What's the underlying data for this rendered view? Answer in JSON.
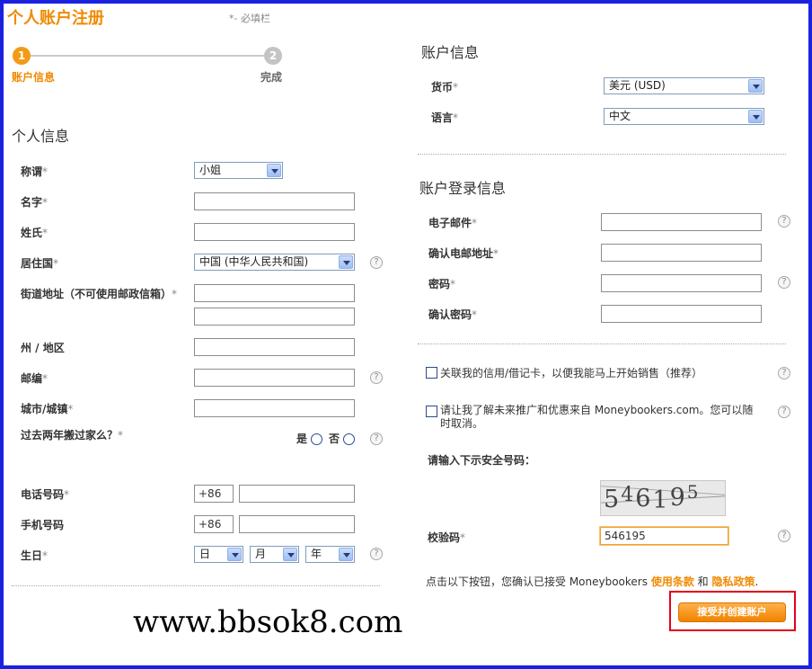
{
  "page": {
    "title": "个人账户注册",
    "required_note": "*- 必填栏"
  },
  "progress": {
    "steps": [
      {
        "number": "1",
        "label": "账户信息"
      },
      {
        "number": "2",
        "label": "完成"
      }
    ]
  },
  "personal": {
    "section_title": "个人信息",
    "title_label": "称谓",
    "title_value": "小姐",
    "first_name_label": "名字",
    "last_name_label": "姓氏",
    "country_label": "居住国",
    "country_value": "中国 (中华人民共和国)",
    "street_label": "街道地址（不可使用邮政信箱）",
    "state_label": "州 / 地区",
    "zip_label": "邮编",
    "city_label": "城市/城镇",
    "moved_label": "过去两年搬过家么？",
    "moved_yes": "是",
    "moved_no": "否",
    "phone_label": "电话号码",
    "phone_code": "+86",
    "mobile_label": "手机号码",
    "mobile_code": "+86",
    "birthday_label": "生日",
    "day_value": "日",
    "month_value": "月",
    "year_value": "年"
  },
  "account": {
    "section_title": "账户信息",
    "currency_label": "货币",
    "currency_value": "美元 (USD)",
    "language_label": "语言",
    "language_value": "中文"
  },
  "login": {
    "section_title": "账户登录信息",
    "email_label": "电子邮件",
    "confirm_email_label": "确认电邮地址",
    "password_label": "密码",
    "confirm_password_label": "确认密码"
  },
  "options": {
    "link_card": "关联我的信用/借记卡，以便我能马上开始销售（推荐）",
    "promo_line1": "请让我了解未来推广和优惠来自 Moneybookers.com。您可以随",
    "promo_line2": "时取消。"
  },
  "security": {
    "prompt": "请输入下示安全号码：",
    "captcha_digits": [
      "5",
      "4",
      "6",
      "1",
      "9",
      "5"
    ],
    "code_label": "校验码",
    "code_value": "546195"
  },
  "agreement": {
    "text": "点击以下按钮，您确认已接受 Moneybookers ",
    "terms": "使用条款",
    "and": " 和 ",
    "privacy": "隐私政策",
    "period": "."
  },
  "submit_label": "接受并创建账户",
  "watermark": "www.bbsok8.com",
  "required_mark": "*",
  "help_glyph": "?",
  "colors": {
    "accent": "#f08a00",
    "frame": "#1a22e0",
    "highlight": "#e2001a"
  }
}
